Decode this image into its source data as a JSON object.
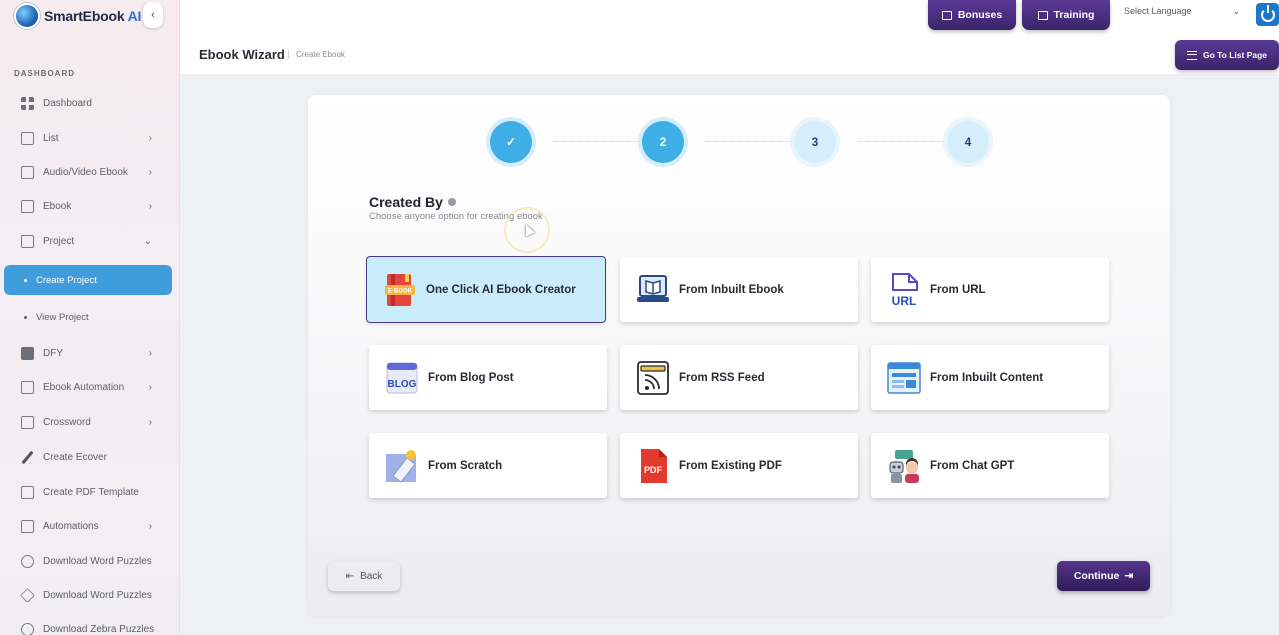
{
  "app": {
    "name": "SmartEbook",
    "name_suffix": "AI"
  },
  "sidebar": {
    "section": "DASHBOARD",
    "items": [
      {
        "label": "Dashboard",
        "icon": "dashboard-icon"
      },
      {
        "label": "List",
        "icon": "list-icon",
        "chevron": "›"
      },
      {
        "label": "Audio/Video Ebook",
        "icon": "book-open-icon",
        "chevron": "›"
      },
      {
        "label": "Ebook",
        "icon": "book-icon",
        "chevron": "›"
      },
      {
        "label": "Project",
        "icon": "project-icon",
        "chevron": "⌄"
      },
      {
        "label": "DFY",
        "icon": "layers-icon",
        "chevron": "›"
      },
      {
        "label": "Ebook Automation",
        "icon": "automation-icon",
        "chevron": "›"
      },
      {
        "label": "Crossword",
        "icon": "crossword-icon",
        "chevron": "›"
      },
      {
        "label": "Create Ecover",
        "icon": "pen-icon"
      },
      {
        "label": "Create PDF Template",
        "icon": "image-icon"
      },
      {
        "label": "Automations",
        "icon": "bank-icon",
        "chevron": "›"
      },
      {
        "label": "Download Word Puzzles",
        "icon": "chip-icon"
      },
      {
        "label": "Download Word Puzzles",
        "icon": "diamond-icon"
      },
      {
        "label": "Download Zebra Puzzles",
        "icon": "refresh-icon"
      }
    ],
    "sub_items": [
      {
        "label": "Create Project",
        "active": true
      },
      {
        "label": "View Project",
        "active": false
      }
    ]
  },
  "header": {
    "title": "Ebook Wizard",
    "breadcrumb": "Create Ebook",
    "bonuses_label": "Bonuses",
    "training_label": "Training",
    "language_placeholder": "Select Language",
    "language_chevron": "⌄",
    "goto_label": "Go To List Page"
  },
  "wizard": {
    "steps": [
      {
        "label": "✓",
        "state": "done"
      },
      {
        "label": "2",
        "state": "current"
      },
      {
        "label": "3",
        "state": "todo"
      },
      {
        "label": "4",
        "state": "todo"
      }
    ],
    "section_title": "Created By",
    "section_subtitle": "Choose anyone option for creating ebook",
    "options": [
      {
        "label": "One Click AI Ebook Creator",
        "icon": "ebook-icon",
        "selected": true
      },
      {
        "label": "From Inbuilt Ebook",
        "icon": "laptop-book-icon",
        "selected": false
      },
      {
        "label": "From URL",
        "icon": "url-icon",
        "selected": false
      },
      {
        "label": "From Blog Post",
        "icon": "blog-icon",
        "selected": false
      },
      {
        "label": "From RSS Feed",
        "icon": "rss-icon",
        "selected": false
      },
      {
        "label": "From Inbuilt Content",
        "icon": "content-icon",
        "selected": false
      },
      {
        "label": "From Scratch",
        "icon": "eraser-icon",
        "selected": false
      },
      {
        "label": "From Existing PDF",
        "icon": "pdf-icon",
        "selected": false
      },
      {
        "label": "From Chat GPT",
        "icon": "chatbot-icon",
        "selected": false
      }
    ],
    "back_label": "Back",
    "back_arrow": "⇤",
    "continue_label": "Continue",
    "continue_arrow": "⇥"
  },
  "colors": {
    "accent_purple": "#3b2468",
    "active_blue": "#3f9ddb",
    "step_blue": "#3eaee6",
    "selected_bg": "#c9ecfb"
  },
  "icon_text": {
    "ebook": "E-BOOK",
    "url": "URL",
    "blog": "BLOG",
    "pdf": "PDF"
  }
}
